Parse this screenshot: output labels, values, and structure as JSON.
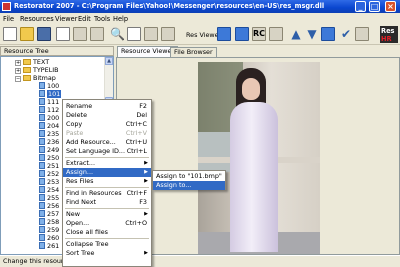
{
  "window": {
    "title": "Restorator 2007 - C:\\Program Files\\Yahoo!\\Messenger\\resources\\en-US\\res_msgr.dll",
    "minimize": "_",
    "maximize": "□",
    "close": "×"
  },
  "menubar": [
    "File",
    "Resources",
    "Viewer",
    "Edit",
    "Tools",
    "Help"
  ],
  "toolbar": {
    "res_viewer_label": "Res Viewer:",
    "logo_line1": "Res",
    "logo_line2": "HR"
  },
  "resource_tree": {
    "header": "Resource Tree",
    "rows": [
      {
        "label": "TEXT",
        "kind": "folder",
        "expander": "+"
      },
      {
        "label": "TYPELIB",
        "kind": "folder",
        "expander": "+"
      },
      {
        "label": "Bitmap",
        "kind": "folder",
        "expander": "−"
      },
      {
        "label": "100",
        "kind": "bitmap"
      },
      {
        "label": "101",
        "kind": "bitmap",
        "selected": true
      },
      {
        "label": "111",
        "kind": "bitmap"
      },
      {
        "label": "112",
        "kind": "bitmap"
      },
      {
        "label": "200",
        "kind": "bitmap"
      },
      {
        "label": "204",
        "kind": "bitmap"
      },
      {
        "label": "235",
        "kind": "bitmap"
      },
      {
        "label": "236",
        "kind": "bitmap"
      },
      {
        "label": "249",
        "kind": "bitmap"
      },
      {
        "label": "250",
        "kind": "bitmap"
      },
      {
        "label": "251",
        "kind": "bitmap"
      },
      {
        "label": "252",
        "kind": "bitmap"
      },
      {
        "label": "253",
        "kind": "bitmap"
      },
      {
        "label": "254",
        "kind": "bitmap"
      },
      {
        "label": "255",
        "kind": "bitmap"
      },
      {
        "label": "256",
        "kind": "bitmap"
      },
      {
        "label": "257",
        "kind": "bitmap"
      },
      {
        "label": "258",
        "kind": "bitmap"
      },
      {
        "label": "259",
        "kind": "bitmap"
      },
      {
        "label": "260",
        "kind": "bitmap"
      },
      {
        "label": "261",
        "kind": "bitmap"
      }
    ]
  },
  "tabs": {
    "active": "Resource Viewer",
    "inactive": "File Browser"
  },
  "context_menu": {
    "items": [
      {
        "label": "Rename",
        "shortcut": "F2"
      },
      {
        "label": "Delete",
        "shortcut": "Del"
      },
      {
        "label": "Copy",
        "shortcut": "Ctrl+C"
      },
      {
        "label": "Paste",
        "shortcut": "Ctrl+V",
        "disabled": true
      },
      {
        "label": "Add Resource...",
        "shortcut": "Ctrl+U"
      },
      {
        "label": "Set Language ID...",
        "shortcut": "Ctrl+L"
      },
      {
        "label": "Extract...",
        "submenu": true
      },
      {
        "label": "Assign...",
        "submenu": true,
        "highlighted": true
      },
      {
        "label": "Res Files",
        "submenu": true
      },
      {
        "label": "Find in Resources",
        "shortcut": "Ctrl+F"
      },
      {
        "label": "Find Next",
        "shortcut": "F3"
      },
      {
        "label": "New",
        "submenu": true
      },
      {
        "label": "Open...",
        "shortcut": "Ctrl+O"
      },
      {
        "label": "Close all files"
      },
      {
        "label": "Collapse Tree"
      },
      {
        "label": "Sort Tree",
        "submenu": true
      }
    ]
  },
  "assign_submenu": {
    "items": [
      "Assign to \"101.bmp\"",
      "Assign to..."
    ]
  },
  "statusbar": {
    "text": "Change this resource"
  }
}
